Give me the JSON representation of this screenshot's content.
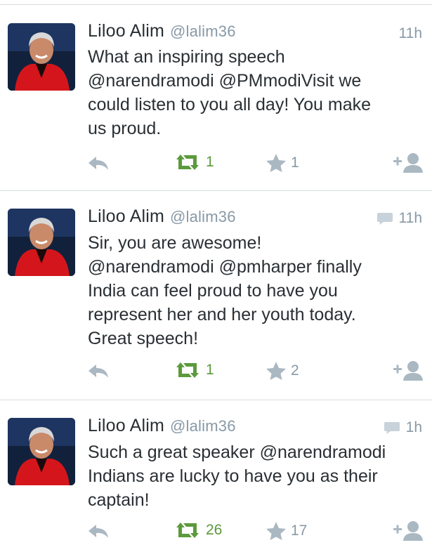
{
  "colors": {
    "text": "#292f33",
    "muted": "#8899a6",
    "icon_gray": "#aab8c2",
    "retweet_green": "#5c9a3c",
    "avatar_bg": "#12213b",
    "jacket_red": "#d4161c"
  },
  "icons": {
    "reply": "reply-arrow-icon",
    "retweet": "retweet-icon",
    "favorite": "star-icon",
    "follow": "add-user-icon",
    "reply_indicator": "speech-bubble-icon"
  },
  "tweets": [
    {
      "name": "Liloo Alim",
      "handle": "@lalim36",
      "time": "11h",
      "has_reply_indicator": false,
      "lines": [
        "What an inspiring speech",
        "@narendramodi @PMmodiVisit we",
        "could listen to you all day!  You make",
        "us proud."
      ],
      "retweets": "1",
      "favorites": "1"
    },
    {
      "name": "Liloo Alim",
      "handle": "@lalim36",
      "time": "11h",
      "has_reply_indicator": true,
      "lines": [
        "Sir, you are awesome!",
        "@narendramodi @pmharper finally",
        "India can feel proud to have you",
        "represent her and her youth today.",
        "Great speech!"
      ],
      "retweets": "1",
      "favorites": "2"
    },
    {
      "name": "Liloo Alim",
      "handle": "@lalim36",
      "time": "1h",
      "has_reply_indicator": true,
      "lines": [
        "Such a great speaker @narendramodi",
        "Indians are lucky to have you as their",
        "captain!"
      ],
      "retweets": "26",
      "favorites": "17"
    }
  ]
}
